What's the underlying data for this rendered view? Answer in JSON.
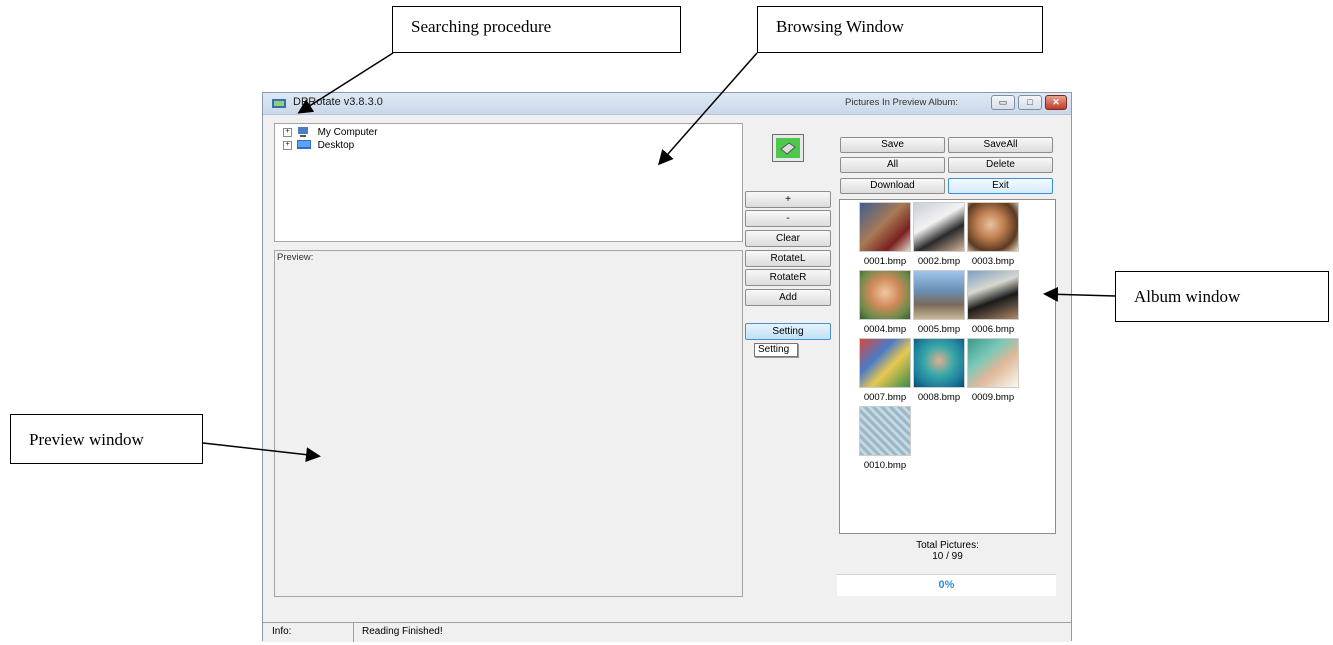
{
  "callouts": {
    "searching": "Searching procedure",
    "browsing": "Browsing Window",
    "album": "Album window",
    "preview": "Preview window"
  },
  "window": {
    "title": "DPRotate v3.8.3.0",
    "controls": [
      "minimize-icon",
      "maximize-icon",
      "close-icon"
    ]
  },
  "tree": {
    "items": [
      {
        "label": "My Computer",
        "icon": "computer-icon"
      },
      {
        "label": "Desktop",
        "icon": "desktop-icon"
      }
    ]
  },
  "preview": {
    "label": "Preview:"
  },
  "middle_buttons": {
    "plus": "+",
    "minus": "-",
    "clear": "Clear",
    "rotate_left": "RotateL",
    "rotate_right": "RotateR",
    "add": "Add",
    "setting": "Setting",
    "tooltip": "Setting"
  },
  "album": {
    "label": "Pictures In Preview Album:",
    "buttons": {
      "save": "Save",
      "save_all": "SaveAll",
      "all": "All",
      "delete": "Delete",
      "download": "Download",
      "exit": "Exit"
    },
    "thumbnails": [
      {
        "name": "0001.bmp"
      },
      {
        "name": "0002.bmp"
      },
      {
        "name": "0003.bmp"
      },
      {
        "name": "0004.bmp"
      },
      {
        "name": "0005.bmp"
      },
      {
        "name": "0006.bmp"
      },
      {
        "name": "0007.bmp"
      },
      {
        "name": "0008.bmp"
      },
      {
        "name": "0009.bmp"
      },
      {
        "name": "0010.bmp"
      }
    ],
    "total_label": "Total Pictures:",
    "total_value": "10 / 99",
    "progress_text": "0%"
  },
  "status": {
    "label": "Info:",
    "message": "Reading Finished!"
  },
  "colors": {
    "accent": "#2f8ed8",
    "close": "#c0392b"
  }
}
